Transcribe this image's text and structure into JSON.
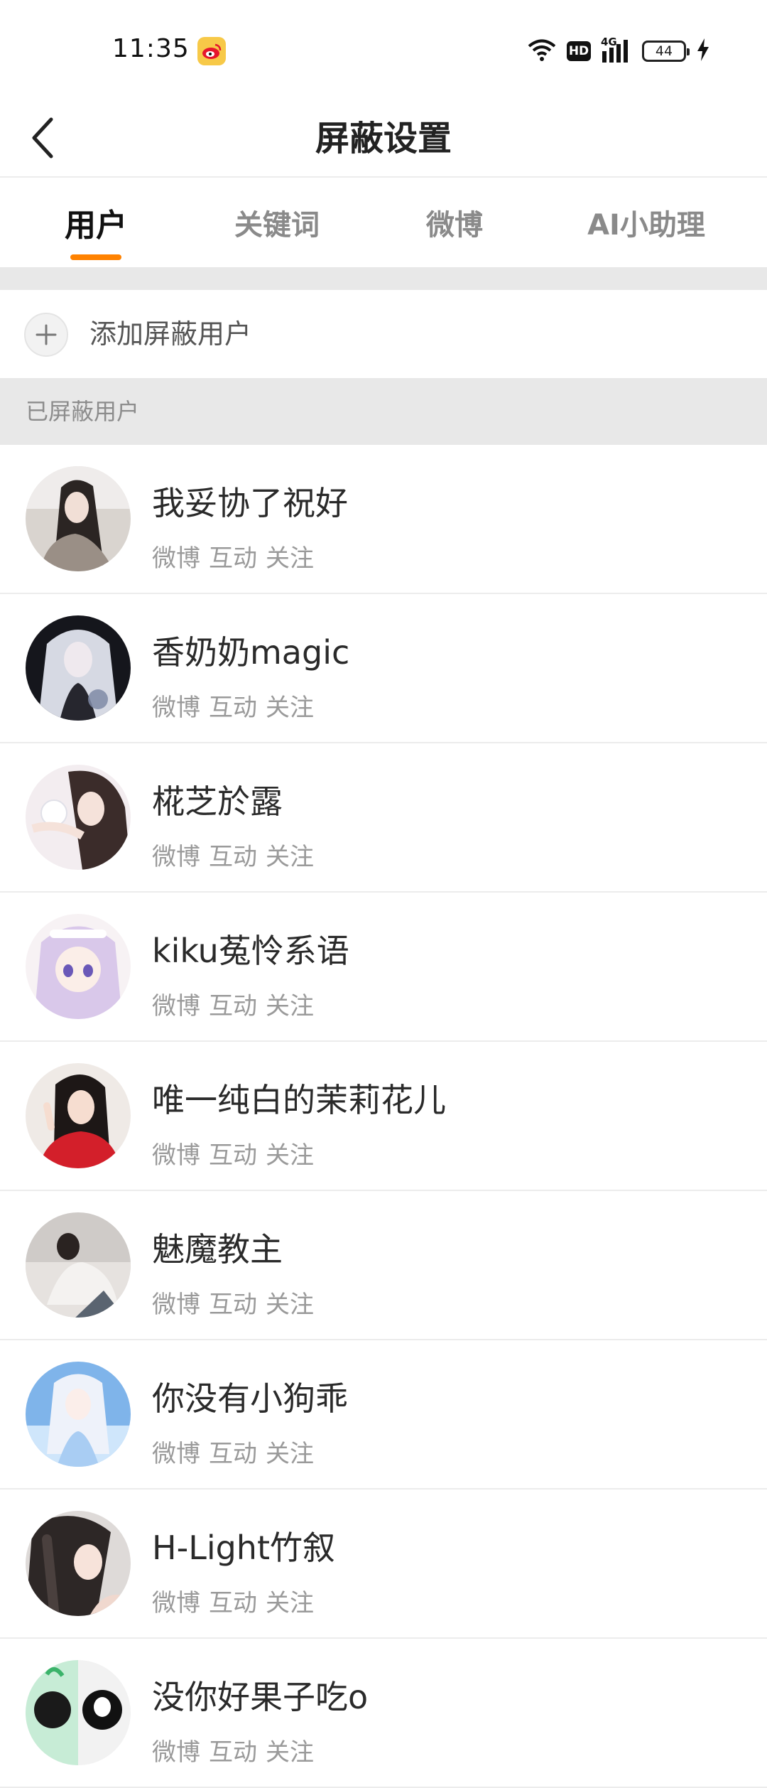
{
  "status_bar": {
    "time": "11:35",
    "hd_label": "HD",
    "network_label": "4G",
    "battery": "44"
  },
  "header": {
    "title": "屏蔽设置"
  },
  "tabs": [
    {
      "label": "用户",
      "active": true
    },
    {
      "label": "关键词",
      "active": false
    },
    {
      "label": "微博",
      "active": false
    },
    {
      "label": "AI小助理",
      "active": false
    }
  ],
  "accent_color": "#ff8200",
  "add_row": {
    "label": "添加屏蔽用户"
  },
  "section": {
    "label": "已屏蔽用户"
  },
  "users": [
    {
      "name": "我妥协了祝好",
      "tags": [
        "微博",
        "互动",
        "关注"
      ]
    },
    {
      "name": "香奶奶magic",
      "tags": [
        "微博",
        "互动",
        "关注"
      ]
    },
    {
      "name": "椛芝於露",
      "tags": [
        "微博",
        "互动",
        "关注"
      ]
    },
    {
      "name": "kiku菟怜系语",
      "tags": [
        "微博",
        "互动",
        "关注"
      ]
    },
    {
      "name": "唯一纯白的茉莉花儿",
      "tags": [
        "微博",
        "互动",
        "关注"
      ]
    },
    {
      "name": "魅魔教主",
      "tags": [
        "微博",
        "互动",
        "关注"
      ]
    },
    {
      "name": "你没有小狗乖",
      "tags": [
        "微博",
        "互动",
        "关注"
      ]
    },
    {
      "name": "H-Light竹叙",
      "tags": [
        "微博",
        "互动",
        "关注"
      ]
    },
    {
      "name": "没你好果子吃o",
      "tags": [
        "微博",
        "互动",
        "关注"
      ]
    }
  ]
}
